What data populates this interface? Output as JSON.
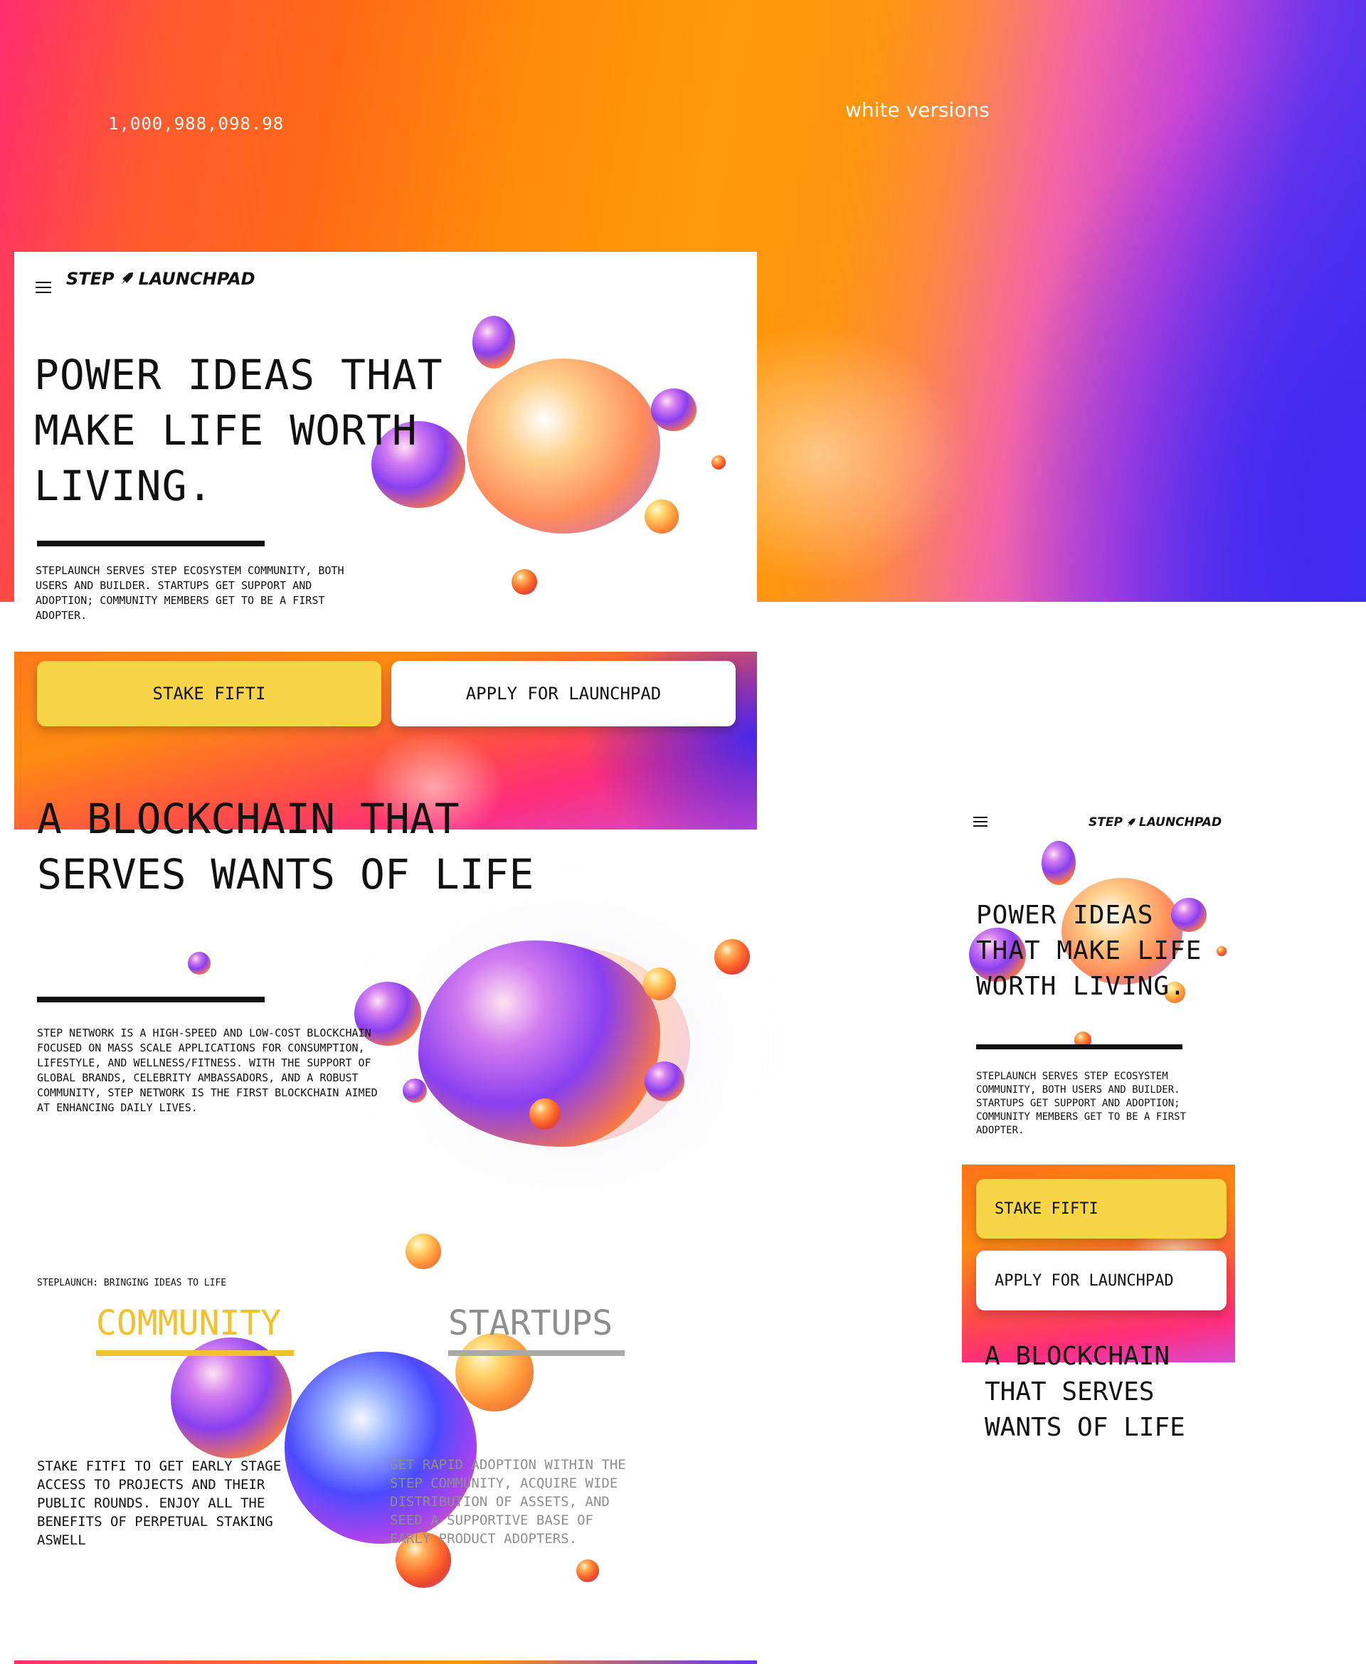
{
  "topbar": {
    "number": "1,000,988,098.98",
    "caption": "white versions"
  },
  "brand": {
    "logo_left": "STEP",
    "logo_right": "LAUNCHPAD",
    "rocket_icon": "rocket-icon"
  },
  "desktop": {
    "hero": {
      "title": " POWER IDEAS THAT\nMAKE LIFE WORTH\nLIVING.",
      "copy": "STEPLAUNCH SERVES STEP ECOSYSTEM COMMUNITY, BOTH USERS AND BUILDER. STARTUPS GET SUPPORT AND ADOPTION; COMMUNITY MEMBERS GET TO BE A FIRST ADOPTER."
    },
    "cta": {
      "stake_label": "STAKE FIFTI",
      "apply_label": "APPLY FOR LAUNCHPAD"
    },
    "blockchain": {
      "title": "A BLOCKCHAIN THAT\nSERVES WANTS OF LIFE",
      "copy": "STEP NETWORK IS A HIGH-SPEED AND LOW-COST BLOCKCHAIN FOCUSED ON MASS SCALE APPLICATIONS FOR CONSUMPTION, LIFESTYLE, AND WELLNESS/FITNESS. WITH THE SUPPORT OF GLOBAL BRANDS, CELEBRITY AMBASSADORS, AND A ROBUST COMMUNITY, STEP NETWORK IS THE FIRST BLOCKCHAIN AIMED AT ENHANCING DAILY LIVES."
    },
    "bringing": {
      "eyebrow": "STEPLAUNCH: BRINGING IDEAS TO LIFE",
      "tabs": [
        {
          "label": "COMMUNITY",
          "active": true
        },
        {
          "label": "STARTUPS",
          "active": false
        }
      ],
      "community_copy": "STAKE FITFI TO GET EARLY STAGE ACCESS TO PROJECTS AND THEIR PUBLIC ROUNDS. ENJOY ALL THE BENEFITS OF PERPETUAL STAKING ASWELL",
      "startups_copy": "GET RAPID ADOPTION WITHIN THE STEP COMMUNITY, ACQUIRE WIDE DISTRIBUTION OF ASSETS, AND SEED A SUPPORTIVE BASE OF EARLY PRODUCT ADOPTERS."
    }
  },
  "mobile": {
    "hero": {
      "title": " POWER IDEAS\nTHAT MAKE LIFE\nWORTH LIVING.",
      "copy": "STEPLAUNCH SERVES STEP ECOSYSTEM COMMUNITY, BOTH USERS AND BUILDER. STARTUPS GET SUPPORT AND ADOPTION; COMMUNITY MEMBERS GET TO BE A FIRST ADOPTER."
    },
    "cta": {
      "stake_label": "STAKE FIFTI",
      "apply_label": "APPLY FOR LAUNCHPAD"
    },
    "blockchain": {
      "title": "A BLOCKCHAIN\nTHAT SERVES\nWANTS OF LIFE"
    }
  },
  "colors": {
    "accent_yellow": "#f8d547",
    "tab_active": "#f2c12e",
    "tab_inactive": "#a9a9a9",
    "text": "#111111"
  },
  "icons": [
    "hamburger-menu-icon",
    "rocket-icon"
  ]
}
